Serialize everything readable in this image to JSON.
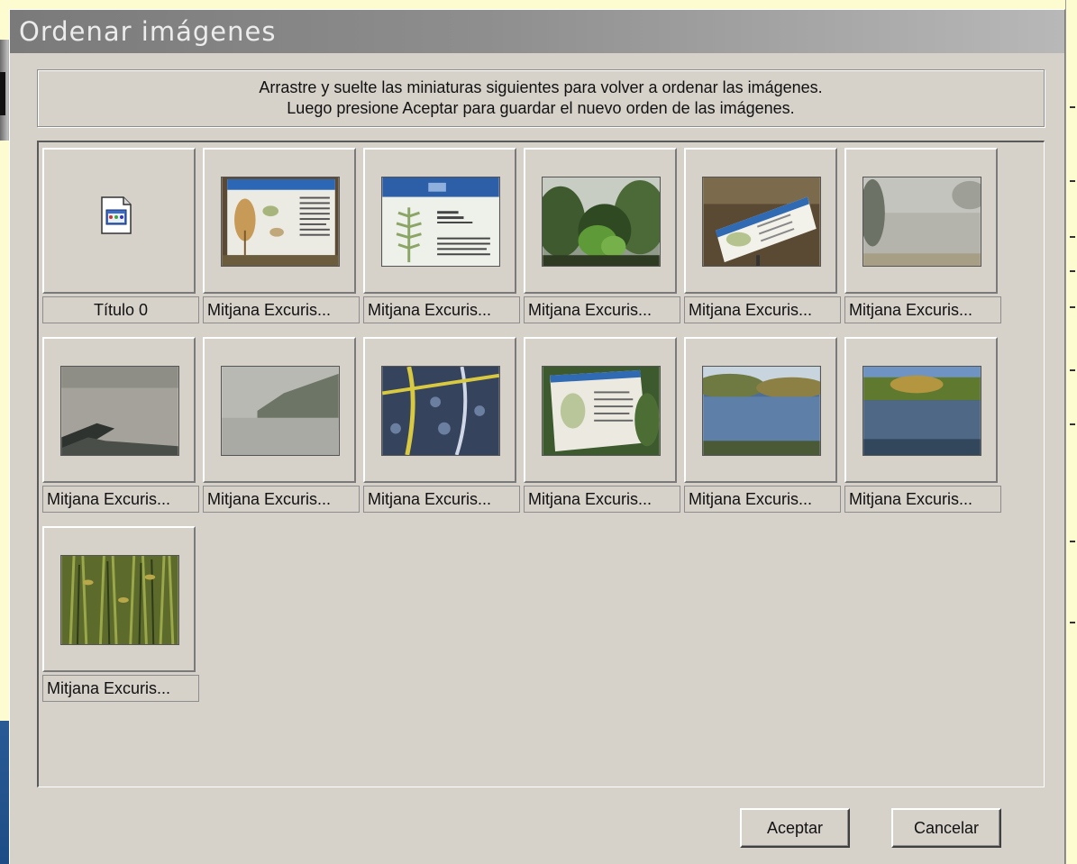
{
  "window": {
    "title": "Ordenar imágenes"
  },
  "instructions": {
    "line1": "Arrastre y suelte las miniaturas siguientes para volver a ordenar las imágenes.",
    "line2": "Luego presione Aceptar para guardar el nuevo orden de las imágenes."
  },
  "thumbnails": [
    {
      "caption": "Título 0",
      "kind": "document-icon"
    },
    {
      "caption": "Mitjana Excuris...",
      "kind": "photo-sign-plant"
    },
    {
      "caption": "Mitjana Excuris...",
      "kind": "photo-sign-fern"
    },
    {
      "caption": "Mitjana Excuris...",
      "kind": "photo-forest"
    },
    {
      "caption": "Mitjana Excuris...",
      "kind": "photo-sign-ground"
    },
    {
      "caption": "Mitjana Excuris...",
      "kind": "photo-fog-river"
    },
    {
      "caption": "Mitjana Excuris...",
      "kind": "photo-fog-boat"
    },
    {
      "caption": "Mitjana Excuris...",
      "kind": "photo-fog-trees"
    },
    {
      "caption": "Mitjana Excuris...",
      "kind": "photo-map"
    },
    {
      "caption": "Mitjana Excuris...",
      "kind": "photo-sign-forest"
    },
    {
      "caption": "Mitjana Excuris...",
      "kind": "photo-river-sunny"
    },
    {
      "caption": "Mitjana Excuris...",
      "kind": "photo-river-blue"
    },
    {
      "caption": "Mitjana Excuris...",
      "kind": "photo-reeds"
    }
  ],
  "buttons": {
    "ok": "Aceptar",
    "cancel": "Cancelar"
  }
}
